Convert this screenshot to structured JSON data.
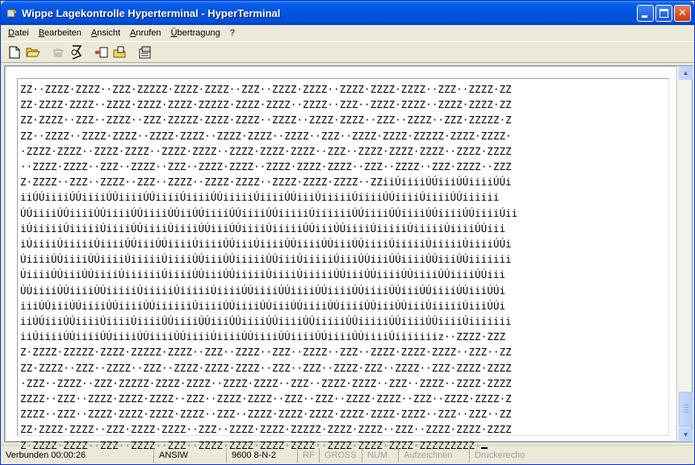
{
  "window": {
    "title": "Wippe Lagekontrolle Hyperterminal - HyperTerminal",
    "minimize_glyph": "",
    "close_glyph": "✕"
  },
  "menu": {
    "items": [
      "Datei",
      "Bearbeiten",
      "Ansicht",
      "Anrufen",
      "Übertragung",
      "?"
    ]
  },
  "toolbar": {
    "icons": [
      "new-document-icon",
      "open-folder-icon",
      "phone-icon",
      "disconnect-phone-icon",
      "send-file-icon",
      "receive-file-icon",
      "properties-icon"
    ]
  },
  "terminal": {
    "lines": [
      "ZZ··ZZZZ·ZZZZ··ZZZ·ZZZZZ·ZZZZ·ZZZZ··ZZZ··ZZZZ·ZZZZ··ZZZZ·ZZZZ·ZZZZ··ZZZ··ZZZZ·ZZ",
      "ZZ·ZZZZ·ZZZZ··ZZZZ·ZZZZ·ZZZZ·ZZZZZ·ZZZZ·ZZZZ··ZZZZ··ZZZ··ZZZZ·ZZZZ··ZZZZ·ZZZZ·ZZ",
      "ZZ·ZZZZ··ZZZ··ZZZZ··ZZZ·ZZZZZ·ZZZZ·ZZZZ··ZZZZ··ZZZZ·ZZZZ··ZZZ··ZZZZ··ZZZ·ZZZZZ·Z",
      "ZZ··ZZZZ··ZZZZ·ZZZZ··ZZZZ·ZZZZ··ZZZZ·ZZZZ··ZZZZ··ZZZ··ZZZZ·ZZZZ·ZZZZZ·ZZZZ·ZZZZ·",
      "·ZZZZ·ZZZZ··ZZZZ·ZZZZ··ZZZZ·ZZZZ··ZZZZ·ZZZZ·ZZZZ··ZZZ··ZZZZ·ZZZZ·ZZZZ··ZZZZ·ZZZZ",
      "··ZZZZ·ZZZZ··ZZZ··ZZZZ··ZZZ··ZZZZ·ZZZZ··ZZZZ·ZZZZ·ZZZZ··ZZZ··ZZZZ··ZZZ·ZZZZ··ZZZ",
      "Z·ZZZZ··ZZZ··ZZZZ··ZZZ··ZZZZ··ZZZZ·ZZZZ··ZZZZ·ZZZZ·ZZZZ··ZZiiÚiiiiÚÚiiiÚÚiiiiÚÚi",
      "iiÚÚiiiiÚÚiiiiÚÚiiiiÚÚiiiiÚiiiiÚÚiiiiiÚiiiiÚÚiiiÚiiiiiÚiiiiÚÚiiiiÚiiiiÚÚiiiiii",
      "ÚÚiiiiÚÚiiiiÚÚiiiiÚÚiiiiÚÚiiÚÚiiiiÚÚiiiiÚÚiiiiiÚiiiiiiÚÚiiiiÚÚiiiiÚÚiiiiÚÚiiiiÚii",
      "iÚiiiiiÚiiiiiÚiiiiÚÚiiiiÚiiiiÚÚiiiÚÚiiiiÚiiiiiÚÚiiiÚÚiiiiÚiiiiiÚiiiiiÚiiiiÚÚiii",
      "iÚiiiiÚiiiiiÚiiiiÚÚiiiÚÚiiiiÚiiiiÚÚiiiÚiiiiÚÚiiiiÚÚiiiÚÚiiiiÚiiiiiÚiiiiiÚiiiiÚÚi",
      "ÚiiiiÚÚiiiiÚÚiiiiÚiiiiiÚiiiiÚÚiiiÚÚiiiiiÚÚiiiÚiiiiiÚiiiÚÚiiiÚÚiiiiÚÚiiiÚÚiiiiiii",
      "ÚiiiiÚÚiiiÚÚiiiiÚiiiiiiÚiiiiÚÚiiiÚÚiiiiiÚiiiiÚiiiiiÚÚiiiÚÚiiiiÚÚiiiiÚÚiiiiÚÚiii",
      "ÚÚiiiiÚÚiiiiÚÚiiiiiÚiiiiiÚiiiiiÚiiiiÚÚiiiiÚÚiiiiÚÚiiiiÚÚiiiiÚÚiiiÚÚiiiiÚÚiiiÚÚi",
      "iiiÚÚiiiÚÚiiiiÚÚiiiiÚÚiiiiiiÚiiiiÚÚiiiiÚÚiiiÚÚiiiiÚÚiiiiÚÚiiiÚÚiiiÚiiiiiÚiiiÚÚi",
      "iiÚÚiiiÚÚiiiiÚiiiiÚiiiiÚÚiiiiÚÚiiiÚÚiiiiÚÚiiiiÚÚiiiiiÚÚiiiiiÚÚiiiiÚÚiiiiÚiiiiiii",
      "iiÚiiiiÚÚiiiiÚÚiiiiÚÚiiiiÚÚiiiiÚiiiiÚÚiiiiÚÚiiiiÚÚiiiiÚÚiiiiÚiiiiiiiz··ZZZZ·ZZZ",
      "Z·ZZZZ·ZZZZZ·ZZZZ·ZZZZZ·ZZZZ··ZZZ··ZZZZ··ZZZ··ZZZZ··ZZZ··ZZZZ·ZZZZ·ZZZZ··ZZZ··ZZ",
      "ZZ·ZZZZ··ZZZ··ZZZZ··ZZZ··ZZZZ·ZZZZ·ZZZZ··ZZZ··ZZZ··ZZZZ·ZZZ··ZZZZ··ZZZ·ZZZZ·ZZZZ",
      "·ZZZ··ZZZZ··ZZZ·ZZZZZ·ZZZZ·ZZZZ··ZZZZ·ZZZZ··ZZZ··ZZZZ·ZZZZ··ZZZ··ZZZZ··ZZZZ·ZZZZ",
      "ZZZZ··ZZZ··ZZZZ·ZZZZ·ZZZZ··ZZZ··ZZZZ·ZZZZ··ZZZ··ZZZ··ZZZZ·ZZZZ··ZZZ··ZZZZ·ZZZZ·Z",
      "ZZZZ··ZZZ··ZZZZ·ZZZZ·ZZZZ·ZZZZ··ZZZ··ZZZZ·ZZZZ·ZZZZ·ZZZZ·ZZZZ·ZZZZ··ZZZ··ZZZ··ZZ",
      "ZZ·ZZZZ·ZZZZ··ZZZ·ZZZZ·ZZZZ··ZZZ··ZZZZ·ZZZZ·ZZZZZ·ZZZZ·ZZZZ··ZZZ··ZZZZ·ZZZZ·ZZZZ",
      "Z·ZZZZ·ZZZZ··ZZZ··ZZZZ··ZZZ··ZZZZ·ZZZZ·ZZZZ·ZZZZ··ZZZZ·ZZZZ·ZZZZ·ZZZZZZZZZ·"
    ]
  },
  "statusbar": {
    "connection": "Verbunden 00:00:26",
    "emulation": "ANSIW",
    "port_settings": "9600 8-N-2",
    "rf": "RF",
    "caps": "GROSS",
    "num": "NUM",
    "capture": "Aufzeichnen",
    "print_echo": "Druckerecho"
  }
}
